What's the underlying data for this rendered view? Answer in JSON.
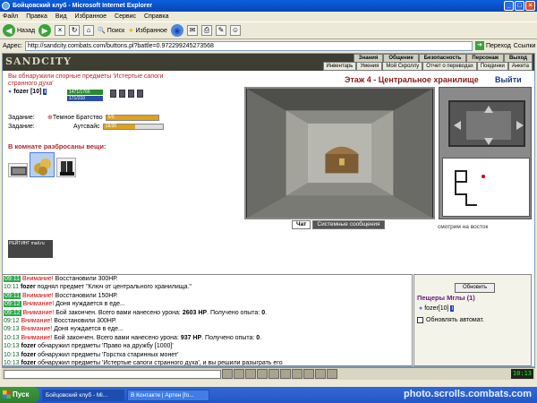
{
  "window": {
    "title": "Бойцовский клуб - Microsoft Internet Explorer",
    "minimize": "_",
    "maximize": "□",
    "close": "×"
  },
  "menu": [
    "Файл",
    "Правка",
    "Вид",
    "Избранное",
    "Сервис",
    "Справка"
  ],
  "toolbar": {
    "back": "Назад",
    "search": "Поиск",
    "favorites": "Избранное"
  },
  "address": {
    "label": "Адрес:",
    "url": "http://sandcity.combats.com/buttons.pl?battle=0.972299245273568",
    "go": "Переход",
    "links": "Ссылки"
  },
  "game": {
    "logo": "SANDCITY",
    "nav_top": [
      "Знания",
      "Общение",
      "Безопасность",
      "Персонаж",
      "Выход"
    ],
    "nav_bottom": [
      "Инвентарь",
      "Умения",
      "Мой Скроллу",
      "Отчет о переводах",
      "Поединки",
      "Анкета"
    ],
    "found_message": "Вы обнаружили спорные предметы 'Истертые сапоги странного духа'",
    "character": {
      "name": "fozer",
      "level": "[10]",
      "hp": "1471/1766",
      "mp": "171/210"
    },
    "tasks": [
      {
        "label": "Задание:",
        "name": "Темное Братство",
        "progress_text": "5/5",
        "progress": 1.0
      },
      {
        "label": "Задание:",
        "name": "Аутсвайс",
        "progress_text": "16/30",
        "progress": 0.53
      }
    ],
    "room_items_title": "В комнате разбросаны вещи:",
    "rating_text": "РЕЙТИНГ mail.ru",
    "floor_title": "Этаж 4 - Центральное хранилище",
    "exit_label": "Выйти",
    "looking": "смотрим на восток"
  },
  "chat": {
    "tab_chat": "Чат",
    "tab_system": "Системные сообщения",
    "lines": [
      {
        "time": "09:11",
        "alert": "Внимание!",
        "text": " Восстановили 300НР."
      },
      {
        "time": "10:11",
        "who": "fozer",
        "text": " поднял предмет \"Ключ от центрального хранилища.\""
      },
      {
        "time": "09:11",
        "alert": "Внимание!",
        "text": " Восстановили 150НР."
      },
      {
        "time": "09:12",
        "alert": "Внимание!",
        "text": " Доня нуждается в еде..."
      },
      {
        "time": "09:12",
        "alert": "Внимание!",
        "text": " Бой закончен. Всего вами нанесено урона: ",
        "dmg": "2603 НР",
        "after": ". Получено опыта: ",
        "exp": "0",
        "end": "."
      },
      {
        "time": "09:12",
        "alert": "Внимание!",
        "text": " Восстановили 300НР."
      },
      {
        "time": "09:13",
        "alert": "Внимание!",
        "text": " Доня нуждается в еде..."
      },
      {
        "time": "10:13",
        "alert": "Внимание!",
        "text": " Бой закончен. Всего вами нанесено урона: ",
        "dmg": "937 НР",
        "after": ". Получено опыта: ",
        "exp": "0",
        "end": "."
      },
      {
        "time": "10:13",
        "who": "fozer",
        "text": " обнаружил предметы 'Право на дружбу [1000]'"
      },
      {
        "time": "10:13",
        "who": "fozer",
        "text": " обнаружил предметы 'Горстка старинных монет'"
      },
      {
        "time": "10:13",
        "who": "fozer",
        "text": " обнаружил предметы 'Истертые сапоги странного духа', и вы решили разыграть его"
      }
    ]
  },
  "side": {
    "refresh": "Обновить",
    "location": "Пещеры Мглы (1)",
    "user": "fozer[10]",
    "auto_refresh": "Обновлять автомат."
  },
  "clock": "10:13",
  "taskbar": {
    "start": "Пуск",
    "items": [
      "Бойцовский клуб - Mi...",
      "В Контакте | Артен [fo..."
    ]
  },
  "watermark": "photo.scrolls.combats.com",
  "colors": {
    "title_blue": "#0A5FDD",
    "alert_red": "#D10000",
    "game_dark": "#3e3e33",
    "taskbar": "#2457C6"
  }
}
